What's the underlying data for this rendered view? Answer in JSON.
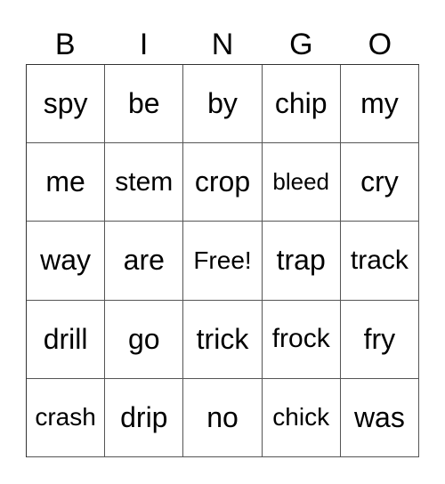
{
  "header": [
    "B",
    "I",
    "N",
    "G",
    "O"
  ],
  "rows": [
    [
      "spy",
      "be",
      "by",
      "chip",
      "my"
    ],
    [
      "me",
      "stem",
      "crop",
      "bleed",
      "cry"
    ],
    [
      "way",
      "are",
      "Free!",
      "trap",
      "track"
    ],
    [
      "drill",
      "go",
      "trick",
      "frock",
      "fry"
    ],
    [
      "crash",
      "drip",
      "no",
      "chick",
      "was"
    ]
  ]
}
